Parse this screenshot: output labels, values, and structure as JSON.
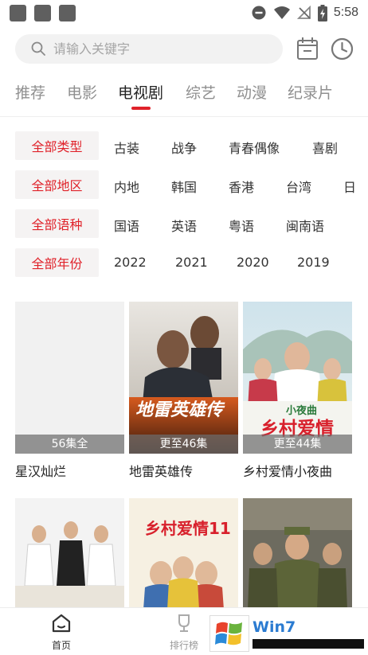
{
  "status_bar": {
    "time": "5:58",
    "icons": [
      "dnd-icon",
      "wifi-icon",
      "no-signal-icon",
      "battery-charging-icon"
    ]
  },
  "search": {
    "placeholder": "请输入关键字"
  },
  "tabs": [
    {
      "label": "推荐",
      "active": false
    },
    {
      "label": "电影",
      "active": false
    },
    {
      "label": "电视剧",
      "active": true
    },
    {
      "label": "综艺",
      "active": false
    },
    {
      "label": "动漫",
      "active": false
    },
    {
      "label": "纪录片",
      "active": false
    }
  ],
  "filters": [
    {
      "head": "全部类型",
      "options": [
        "古装",
        "战争",
        "青春偶像",
        "喜剧"
      ]
    },
    {
      "head": "全部地区",
      "options": [
        "内地",
        "韩国",
        "香港",
        "台湾",
        "日"
      ]
    },
    {
      "head": "全部语种",
      "options": [
        "国语",
        "英语",
        "粤语",
        "闽南语"
      ]
    },
    {
      "head": "全部年份",
      "options": [
        "2022",
        "2021",
        "2020",
        "2019"
      ]
    }
  ],
  "shows": [
    {
      "title": "星汉灿烂",
      "badge": "56集全",
      "poster_text": ""
    },
    {
      "title": "地雷英雄传",
      "badge": "更至46集",
      "poster_text": "地雷英雄传"
    },
    {
      "title": "乡村爱情小夜曲",
      "badge": "更至44集",
      "poster_text": "乡村爱情",
      "poster_subtext": "小夜曲"
    },
    {
      "title": "",
      "badge": "",
      "poster_text": ""
    },
    {
      "title": "",
      "badge": "",
      "poster_text": "乡村爱情11"
    },
    {
      "title": "",
      "badge": "",
      "poster_text": ""
    }
  ],
  "bottom_nav": [
    {
      "label": "首页",
      "icon": "home-icon",
      "active": true
    },
    {
      "label": "排行榜",
      "icon": "trophy-icon",
      "active": false
    }
  ],
  "watermark": {
    "text": "Win7"
  },
  "colors": {
    "accent": "#e0222a",
    "tab_inactive": "#8f8f8f",
    "filter_bg": "#f5f3f3"
  }
}
